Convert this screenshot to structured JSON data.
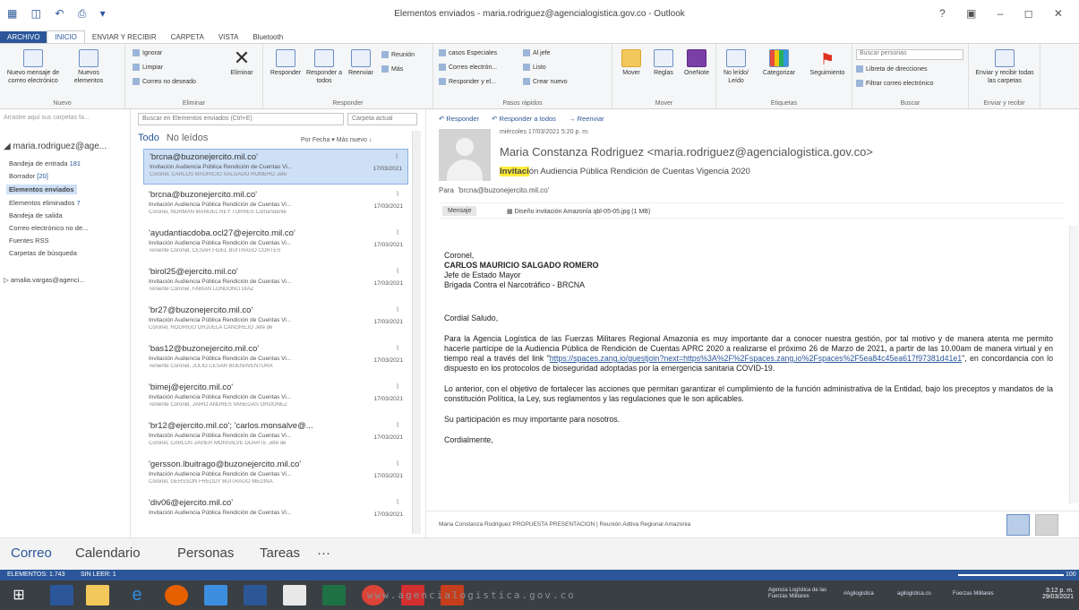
{
  "window": {
    "title": "Elementos enviados - maria.rodriguez@agencialogistica.gov.co - Outlook",
    "quick_access": "▦ ◫ ↶ ⎙ ▾",
    "controls": "? ▣ – ◻ ✕"
  },
  "ribbon_tabs": [
    "ARCHIVO",
    "INICIO",
    "ENVIAR Y RECIBIR",
    "CARPETA",
    "VISTA",
    "Bluetooth"
  ],
  "ribbon": {
    "nuevo": {
      "label": "Nuevo",
      "new_mail": "Nuevo mensaje de correo electrónico",
      "new_items": "Nuevos elementos"
    },
    "eliminar": {
      "label": "Eliminar",
      "ignore": "Ignorar",
      "cleanup": "Limpiar",
      "junk": "Correo no deseado",
      "delete": "Eliminar"
    },
    "responder": {
      "label": "Responder",
      "reply": "Responder",
      "reply_all": "Responder a todos",
      "forward": "Reenviar",
      "meeting": "Reunión",
      "more": "Más"
    },
    "pasos": {
      "label": "Pasos rápidos",
      "items": [
        "casos Especiales",
        "Correo electrón...",
        "Responder y el...",
        "Al jefe",
        "Listo",
        "Crear nuevo"
      ]
    },
    "mover": {
      "label": "Mover",
      "move": "Mover",
      "rules": "Reglas",
      "onenote": "OneNote"
    },
    "etiquetas": {
      "label": "Etiquetas",
      "unread": "No leído/ Leído",
      "categorize": "Categorizar",
      "followup": "Seguimiento"
    },
    "buscar": {
      "label": "Buscar",
      "search_people": "Buscar personas",
      "address_book": "Libreta de direcciones",
      "filter": "Filtrar correo electrónico"
    },
    "enviar": {
      "label": "Enviar y recibir",
      "button": "Enviar y recibir todas las carpetas"
    }
  },
  "folder_pane": {
    "drop_hint": "Arrastre aquí sus carpetas fa...",
    "account1": "◢ maria.rodriguez@age...",
    "folders": [
      {
        "name": "Bandeja de entrada",
        "count": "181"
      },
      {
        "name": "Borrador",
        "count": "[20]"
      },
      {
        "name": "Elementos enviados",
        "count": ""
      },
      {
        "name": "Elementos eliminados",
        "count": "7"
      },
      {
        "name": "Bandeja de salida",
        "count": ""
      },
      {
        "name": "Correo electrónico no de...",
        "count": ""
      },
      {
        "name": "Fuentes RSS",
        "count": ""
      },
      {
        "name": "Carpetas de búsqueda",
        "count": ""
      }
    ],
    "account2": "▷ amalia.vargas@agenci..."
  },
  "message_list": {
    "search_placeholder": "Buscar en Elementos enviados (Ctrl+E)",
    "scope": "Carpeta actual",
    "filter_all": "Todo",
    "filter_unread": "No leídos",
    "sort": "Por Fecha ▾   Más nuevo ↓",
    "messages": [
      {
        "from": "'brcna@buzonejercito.mil.co'",
        "subject": "Invitación Audiencia Pública Rendición de Cuentas Vi...",
        "date": "17/03/2021",
        "preview": "Coronel,  CARLOS MAURICIO SALGADO ROMERO  Jefe"
      },
      {
        "from": "'brcna@buzonejercito.mil.co'",
        "subject": "Invitación Audiencia Pública Rendición de Cuentas Vi...",
        "date": "17/03/2021",
        "preview": "Coronel,  NORMAN MANUEL REY TORRES  Comandante"
      },
      {
        "from": "'ayudantiacdoba.ocl27@ejercito.mil.co'",
        "subject": "Invitación Audiencia Pública Rendición de Cuentas Vi...",
        "date": "17/03/2021",
        "preview": "Teniente Coronel,  CESAR FIDEL BUITRAGO CORTÉS"
      },
      {
        "from": "'birol25@ejercito.mil.co'",
        "subject": "Invitación Audiencia Pública Rendición de Cuentas Vi...",
        "date": "17/03/2021",
        "preview": "Teniente Coronel,  FABIÁN LONDOÑO DÍAZ"
      },
      {
        "from": "'br27@buzonejercito.mil.co'",
        "subject": "Invitación Audiencia Pública Rendición de Cuentas Vi...",
        "date": "17/03/2021",
        "preview": "Coronel,  RODRIGO ORJUELA CANGREJO  Jefe de"
      },
      {
        "from": "'bas12@buzonejercito.mil.co'",
        "subject": "Invitación Audiencia Pública Rendición de Cuentas Vi...",
        "date": "17/03/2021",
        "preview": "Teniente Coronel,  JULIO CÉSAR BUENAVENTURA"
      },
      {
        "from": "'bimej@ejercito.mil.co'",
        "subject": "Invitación Audiencia Pública Rendición de Cuentas Vi...",
        "date": "17/03/2021",
        "preview": "Teniente Coronel,  JAIRO ANDRÉS VANEGAS ORDOÑEZ"
      },
      {
        "from": "'br12@ejercito.mil.co'; 'carlos.monsalve@...",
        "subject": "Invitación Audiencia Pública Rendición de Cuentas Vi...",
        "date": "17/03/2021",
        "preview": "Coronel,  CARLOS JAVIER MONSALVE DUARTE  Jefe de"
      },
      {
        "from": "'gersson.lbuitrago@buzonejercito.mil.co'",
        "subject": "Invitación Audiencia Pública Rendición de Cuentas Vi...",
        "date": "17/03/2021",
        "preview": "Coronel,  GERSSON FREDDY BUITRAGO MEDINA"
      },
      {
        "from": "'div06@ejercito.mil.co'",
        "subject": "Invitación Audiencia Pública Rendición de Cuentas Vi...",
        "date": "17/03/2021",
        "preview": ""
      }
    ]
  },
  "reading_pane": {
    "reply": "Responder",
    "reply_all": "Responder a todos",
    "forward": "Reenviar",
    "sent_date": "miércoles 17/03/2021 5:20 p. m.",
    "sender": "Maria Constanza Rodriguez <maria.rodriguez@agencialogistica.gov.co>",
    "subject_highlight": "Invitaci",
    "subject_rest": "ón Audiencia Pública Rendición de Cuentas Vigencia 2020",
    "to_label": "Para",
    "to_value": "'brcna@buzonejercito.mil.co'",
    "message_tab": "Mensaje",
    "attachment": "Diseño invitación Amazonía qbl-05-05.jpg (1 MB)",
    "body": {
      "l1": "Coronel,",
      "l2": "CARLOS MAURICIO SALGADO ROMERO",
      "l3": "Jefe de Estado Mayor",
      "l4": "Brigada Contra el Narcotráfico - BRCNA",
      "greeting": "Cordial Saludo,",
      "p1a": "Para la Agencia Logística de las Fuerzas Militares Regional Amazonia es muy importante dar a conocer nuestra gestión, por tal motivo y de manera atenta me permito hacerle partícipe de la Audiencia Pública de Rendición de Cuentas APRC 2020 a realizarse el próximo 26 de Marzo de 2021, a partir de las 10.00am de manera virtual y en tiempo real a través del link \"",
      "link": "https://spaces.zang.io/guestjoin?next=https%3A%2F%2Fspaces.zang.io%2Fspaces%2F5ea84c45ea617f97381d41e1",
      "p1b": "\", en concordancia con lo dispuesto en los protocolos de bioseguridad adoptadas por la emergencia sanitaria COVID-19.",
      "p2": "Lo anterior, con el objetivo de fortalecer las acciones que permitan garantizar el cumplimiento de la función administrativa de la Entidad, bajo los preceptos y mandatos de la constitución Política, la Ley, sus reglamentos y las regulaciones que le son aplicables.",
      "p3": "Su participación es muy importante para nosotros.",
      "closing": "Cordialmente,"
    },
    "people_bar": "Maria Constanza Rodriguez  PROPUESTA PRESENTACION  |  Reunión Adtiva Regional Amazonia"
  },
  "nav": [
    "Correo",
    "Calendario",
    "Personas",
    "Tareas",
    "···"
  ],
  "status": {
    "items": "ELEMENTOS: 1.743",
    "unread": "SIN LEER: 1",
    "zoom": "100"
  },
  "taskbar": {
    "watermark": "www.agencialogistica.gov.co",
    "tray1": "Agencia Logística de las Fuerzas Militares",
    "tray2": "#Agilogistica",
    "tray3": "agilogistica.co",
    "tray4": "Fuerzas Militares",
    "time": "3:12 p. m.",
    "date": "29/03/2021"
  },
  "colors": {
    "accent": "#2b579a",
    "selection": "#cde0f6",
    "highlight": "#ffeb3b",
    "taskbar": "#3a3f44"
  }
}
